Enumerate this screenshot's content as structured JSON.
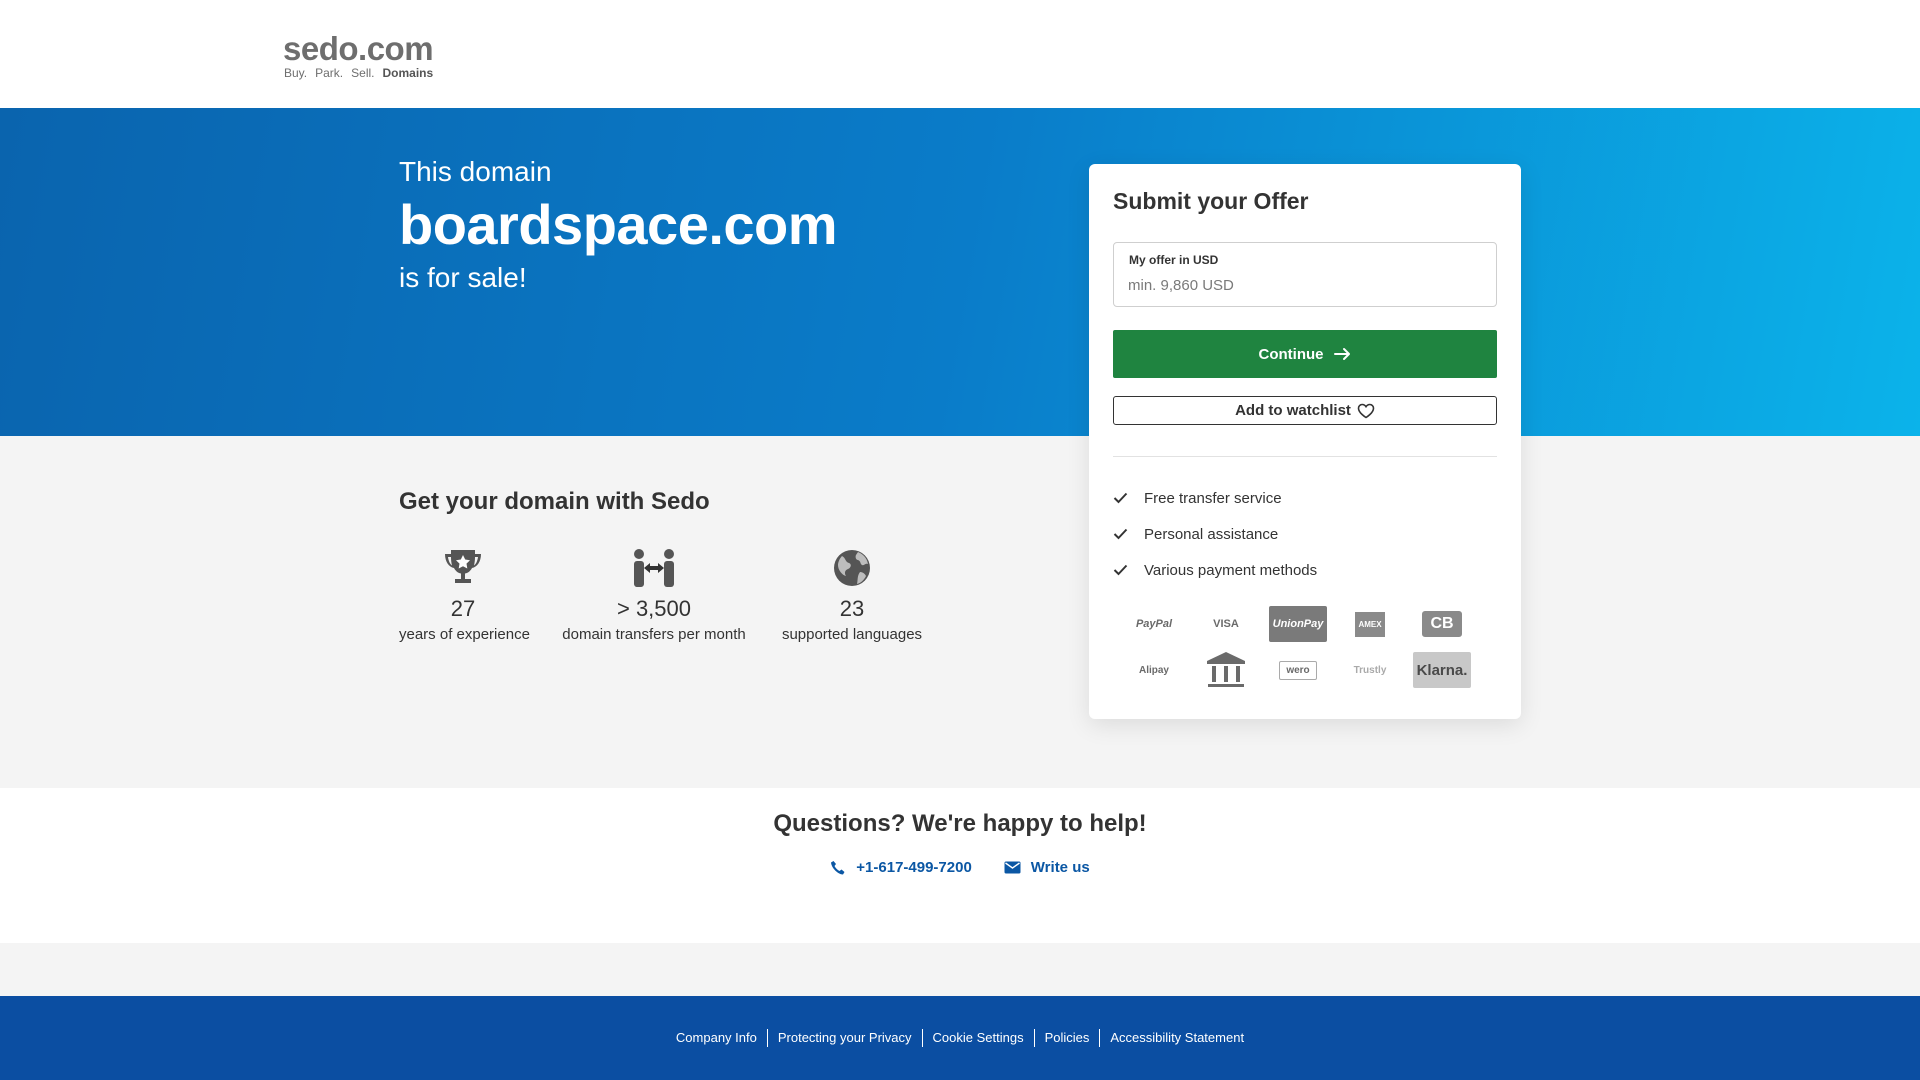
{
  "header": {
    "logo_text": "sedo.com",
    "tagline": [
      "Buy.",
      "Park.",
      "Sell."
    ],
    "tagline_strong": "Domains"
  },
  "hero": {
    "pre": "This domain",
    "domain": "boardspace.com",
    "post": "is for sale!",
    "gradient_colors": [
      "#0a64ae",
      "#0bb3ea"
    ]
  },
  "section": {
    "title": "Get your domain with Sedo",
    "stats": [
      {
        "icon": "trophy-icon",
        "value": "27",
        "label": "years of experience"
      },
      {
        "icon": "transfer-icon",
        "value": "> 3,500",
        "label": "domain transfers per month"
      },
      {
        "icon": "globe-icon",
        "value": "23",
        "label": "supported languages"
      }
    ]
  },
  "offer": {
    "title": "Submit your Offer",
    "field_label": "My offer in USD",
    "placeholder": "min. 9,860 USD",
    "continue_label": "Continue",
    "watchlist_label": "Add to watchlist",
    "features": [
      "Free transfer service",
      "Personal assistance",
      "Various payment methods"
    ],
    "payment_methods": [
      "PayPal",
      "VISA",
      "UnionPay",
      "AMEX",
      "CB",
      "Alipay",
      "Bank",
      "wero",
      "Trustly",
      "Klarna."
    ],
    "accent_color": "#1f8440"
  },
  "help": {
    "title": "Questions? We're happy to help!",
    "phone": "+1-617-499-7200",
    "write": "Write us",
    "link_color": "#0b57a4"
  },
  "footer": {
    "links": [
      "Company Info",
      "Protecting your Privacy",
      "Cookie Settings",
      "Policies",
      "Accessibility Statement"
    ],
    "background": "#0b4ea2"
  }
}
